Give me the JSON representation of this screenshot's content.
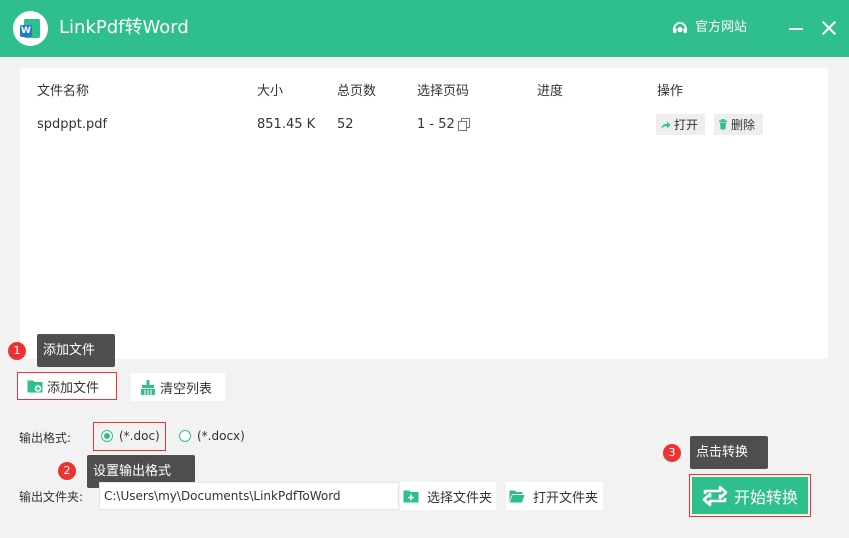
{
  "window": {
    "title": "LinkPdf转Word",
    "site_link": "官方网站"
  },
  "table": {
    "headers": [
      "文件名称",
      "大小",
      "总页数",
      "选择页码",
      "进度",
      "操作"
    ],
    "rows": [
      {
        "name": "spdppt.pdf",
        "size": "851.45 K",
        "pages": "52",
        "range": "1 - 52",
        "progress": "",
        "open_label": "打开",
        "delete_label": "删除"
      }
    ]
  },
  "toolbar": {
    "add_file": "添加文件",
    "clear_list": "清空列表"
  },
  "format": {
    "label": "输出格式:",
    "options": [
      "(*.doc)",
      "(*.docx)"
    ],
    "selected": "(*.doc)"
  },
  "output": {
    "label": "输出文件夹:",
    "path": "C:\\Users\\my\\Documents\\LinkPdfToWord",
    "choose_folder": "选择文件夹",
    "open_folder": "打开文件夹"
  },
  "start_button": "开始转换",
  "tips": [
    {
      "num": "1",
      "text": "添加文件"
    },
    {
      "num": "2",
      "text": "设置输出格式"
    },
    {
      "num": "3",
      "text": "点击转换"
    }
  ],
  "colors": {
    "accent": "#2fbf8c",
    "highlight": "#ee3333",
    "tooltip": "#4e4e4e"
  }
}
